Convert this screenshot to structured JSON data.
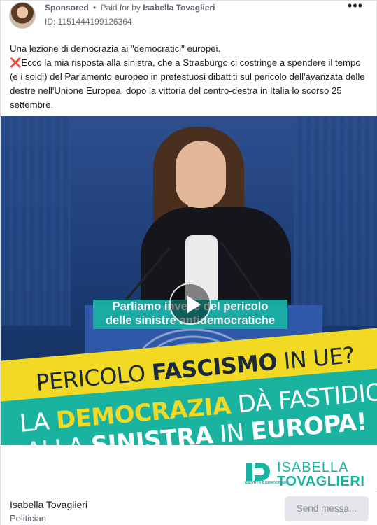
{
  "header": {
    "sponsored": "Sponsored",
    "separator": "•",
    "paid_for_prefix": "Paid for by",
    "paid_for_name": "Isabella Tovaglieri",
    "ad_id": "ID: 1151444199126364",
    "more_icon": "more-horizontal-icon"
  },
  "caption": {
    "line1": "Una lezione di democrazia ai \"democratici\" europei.",
    "x_icon": "❌",
    "body": "Ecco la mia risposta alla sinistra, che a Strasburgo ci costringe a spendere il tempo (e i soldi) del Parlamento europeo in pretestuosi dibattiti sul pericolo dell'avanzata delle destre nell'Unione Europea, dopo la vittoria del centro-destra in Italia lo scorso 25 settembre."
  },
  "video": {
    "subtitle_line1": "Parliamo invece del pericolo",
    "subtitle_line2": "delle sinistre antidemocratiche",
    "play_icon": "play-icon",
    "headline1_a": "PERICOLO ",
    "headline1_b": "FASCISMO",
    "headline1_c": " IN UE?",
    "headline2_a": "LA ",
    "headline2_b": "DEMOCRAZIA",
    "headline2_c": " DÀ FASTIDIO",
    "headline3_a": "ALLA ",
    "headline3_b": "SINISTRA",
    "headline3_c": " IN ",
    "headline3_d": "EUROPA!",
    "brand_tag": "IDENTITÀ E DEMOCRAZIA",
    "brand_name1": "ISABELLA",
    "brand_name2": "TOVAGLIERI"
  },
  "footer": {
    "page_name": "Isabella Tovaglieri",
    "page_category": "Politician",
    "send_button": "Send messa..."
  },
  "colors": {
    "teal": "#1ab3a0",
    "yellow": "#f2d923",
    "text": "#1c1e21",
    "muted": "#606770"
  }
}
